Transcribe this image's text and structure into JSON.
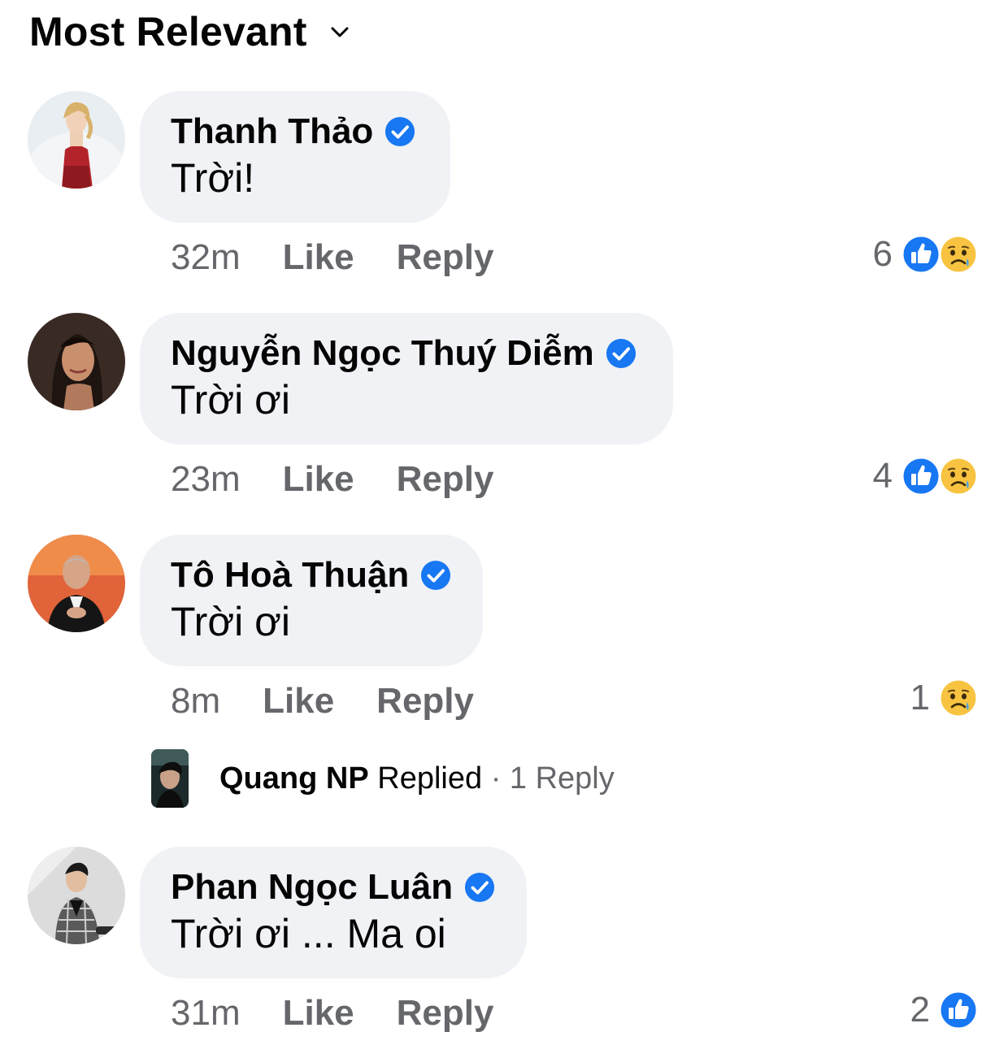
{
  "header": {
    "sort_label": "Most Relevant"
  },
  "colors": {
    "bubble_bg": "#f0f2f5",
    "meta_text": "#65676b",
    "verified_blue": "#1877f2",
    "like_blue": "#1877f2"
  },
  "actions": {
    "like_label": "Like",
    "reply_label": "Reply"
  },
  "comments": [
    {
      "author": "Thanh Thảo",
      "text": "Trời!",
      "time": "32m",
      "reaction_count": "6",
      "reactions": [
        "like-icon",
        "sad-icon"
      ],
      "verified": true
    },
    {
      "author": "Nguyễn Ngọc Thuý Diễm",
      "text": "Trời ơi",
      "time": "23m",
      "reaction_count": "4",
      "reactions": [
        "like-icon",
        "sad-icon"
      ],
      "verified": true
    },
    {
      "author": "Tô Hoà Thuận",
      "text": "Trời ơi",
      "time": "8m",
      "reaction_count": "1",
      "reactions": [
        "sad-icon"
      ],
      "verified": true,
      "reply_summary": {
        "name": "Quang NP",
        "verb": "Replied",
        "count": "· 1 Reply"
      }
    },
    {
      "author": "Phan Ngọc Luân",
      "text": "Trời ơi ... Ma oi",
      "time": "31m",
      "reaction_count": "2",
      "reactions": [
        "like-icon"
      ],
      "verified": true
    }
  ]
}
